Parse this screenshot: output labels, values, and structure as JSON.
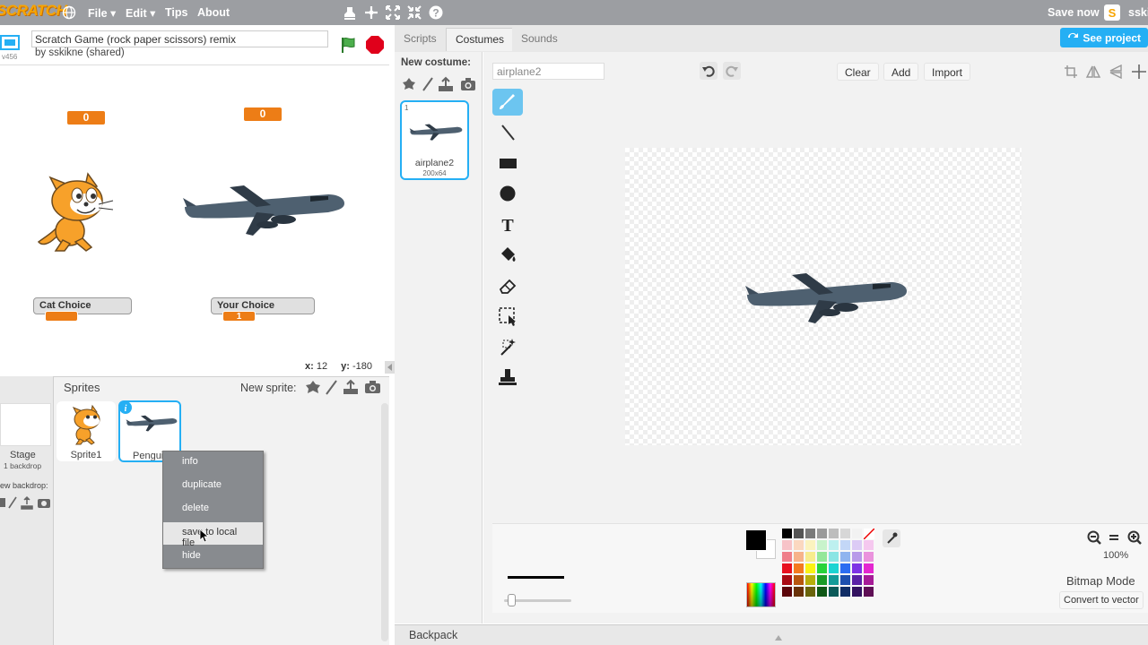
{
  "menubar": {
    "logo": "SCRATCH",
    "file": "File ▾",
    "edit": "Edit ▾",
    "tips": "Tips",
    "about": "About",
    "save_now": "Save now",
    "user": "sski"
  },
  "project": {
    "title": "Scratch Game (rock paper scissors) remix",
    "byline": "by sskikne (shared)",
    "version": "v456"
  },
  "stage": {
    "monitor_top_left": "0",
    "monitor_top_right": "0",
    "cat_choice_label": "Cat Choice",
    "cat_choice_value": "",
    "your_choice_label": "Your Choice",
    "your_choice_value": "1",
    "coords_x_label": "x:",
    "coords_x": "12",
    "coords_y_label": "y:",
    "coords_y": "-180"
  },
  "sprites_pane": {
    "title": "Sprites",
    "new_sprite": "New sprite:",
    "stage_label": "Stage",
    "stage_sub": "1 backdrop",
    "new_backdrop": "ew backdrop:",
    "sprites": [
      {
        "name": "Sprite1"
      },
      {
        "name": "Pengui"
      }
    ]
  },
  "context_menu": {
    "items": [
      "info",
      "duplicate",
      "delete",
      "save to local file",
      "hide"
    ]
  },
  "tabs": {
    "scripts": "Scripts",
    "costumes": "Costumes",
    "sounds": "Sounds",
    "see_project": "See project"
  },
  "costumes": {
    "new_costume": "New costume:",
    "items": [
      {
        "index": "1",
        "name": "airplane2",
        "size": "200x64"
      }
    ]
  },
  "editor": {
    "costume_name": "airplane2",
    "clear": "Clear",
    "add": "Add",
    "import": "Import",
    "zoom": "100%",
    "mode": "Bitmap Mode",
    "convert": "Convert to vector"
  },
  "backpack": {
    "label": "Backpack"
  },
  "colors": {
    "menubar": "#9c9ea2",
    "accent": "#25aff4",
    "tool_selected": "#6cc5f0",
    "monitor_orange": "#ed7d16",
    "green_flag": "#4cae4c",
    "stop_red": "#e0001b"
  },
  "palette": [
    [
      "#000000",
      "#555555",
      "#7a7a7a",
      "#9a9a9a",
      "#bdbdbd",
      "#d7d7d7",
      "#f2f2f2",
      "#ffffff"
    ],
    [
      "#f7c3c8",
      "#fbd8c0",
      "#fbf3bf",
      "#c8f3cb",
      "#bdf0ef",
      "#c3d7f7",
      "#dccbf5",
      "#f5c8ef"
    ],
    [
      "#ef7f8a",
      "#f7b38a",
      "#f7ec8e",
      "#94e79a",
      "#8be5e4",
      "#8fb4ef",
      "#b89ae9",
      "#ea93dd"
    ],
    [
      "#e8101e",
      "#f47a1f",
      "#faf213",
      "#28d33a",
      "#1bd4d2",
      "#2b6df1",
      "#7e33e5",
      "#e427d0"
    ],
    [
      "#a80a13",
      "#b8560f",
      "#b8ae0c",
      "#1a9b27",
      "#139b99",
      "#1d4fae",
      "#5a22a6",
      "#a61b97"
    ],
    [
      "#5c050a",
      "#6a3209",
      "#6a640a",
      "#0f5816",
      "#0b5a59",
      "#102d66",
      "#331361",
      "#5f0f56"
    ]
  ]
}
